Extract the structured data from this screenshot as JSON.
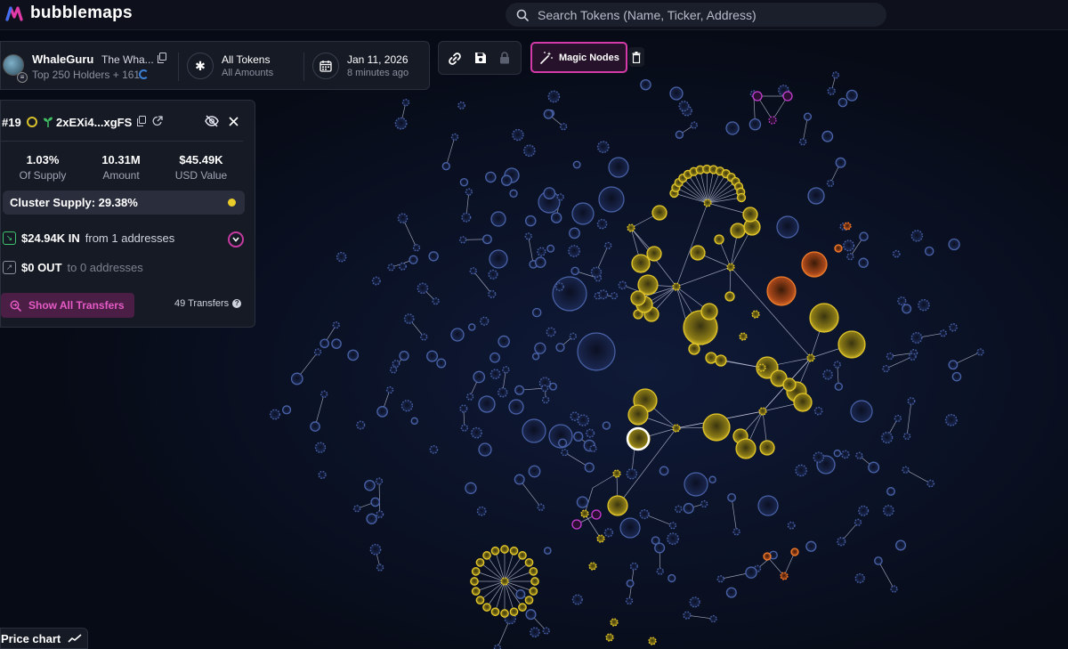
{
  "header": {
    "logo_text": "bubblemaps",
    "search_placeholder": "Search Tokens (Name, Ticker, Address)"
  },
  "info_bar": {
    "wallet_name": "WhaleGuru",
    "wallet_subtitle": "The Wha...",
    "holders_text": "Top 250 Holders + 161",
    "tokens_label": "All Tokens",
    "tokens_sub": "All Amounts",
    "date_label": "Jan 11, 2026",
    "date_sub": "8 minutes ago"
  },
  "toolbar": {
    "magic_nodes_label": "Magic Nodes"
  },
  "detail": {
    "rank": "#19",
    "address": "2xEXi4...xgFS",
    "stats": [
      {
        "value": "1.03%",
        "label": "Of Supply"
      },
      {
        "value": "10.31M",
        "label": "Amount"
      },
      {
        "value": "$45.49K",
        "label": "USD Value"
      }
    ],
    "cluster_supply": "Cluster Supply: 29.38%",
    "in_amount": "$24.94K IN",
    "in_from": "from 1 addresses",
    "out_amount": "$0 OUT",
    "out_to": "to 0 addresses",
    "show_transfers": "Show All Transfers",
    "transfers_count": "49 Transfers"
  },
  "price_chart_label": "Price chart",
  "colors": {
    "background": "#070b16",
    "node_blue": "#4a63a8",
    "node_yellow": "#e2c62a",
    "node_orange": "#f07b2a",
    "node_magenta": "#c83ed1",
    "accent_pink": "#d53ba8"
  }
}
